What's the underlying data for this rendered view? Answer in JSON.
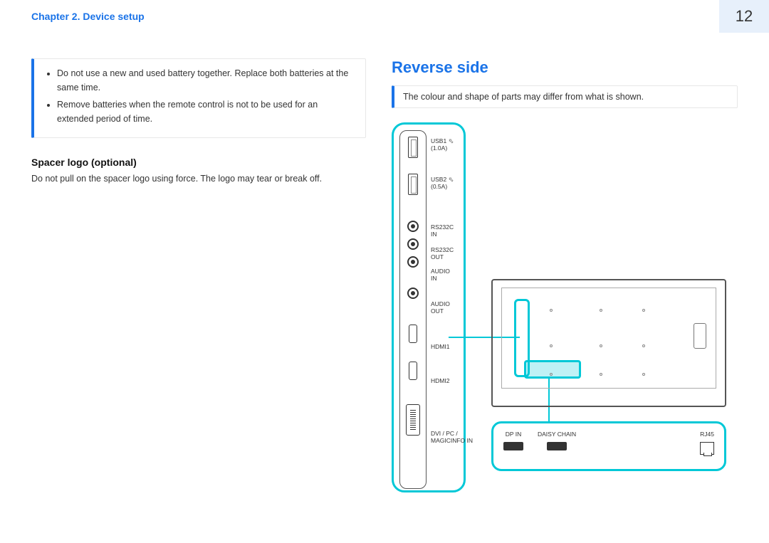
{
  "header": {
    "breadcrumb": "Chapter 2. Device setup",
    "page_number": "12"
  },
  "left": {
    "info_items": [
      "Do not use a new and used battery together. Replace both batteries at the same time.",
      "Remove batteries when the remote control is not to be used for an extended period of time."
    ],
    "spacer_heading": "Spacer logo (optional)",
    "spacer_body": "Do not pull on the spacer logo using force. The logo may tear or break off."
  },
  "right": {
    "title": "Reverse side",
    "note": "The colour and shape of parts may differ from what is shown.",
    "port_labels": {
      "usb1": "USB1",
      "usb1_amp": "(1.0A)",
      "usb2": "USB2",
      "usb2_amp": "(0.5A)",
      "rs232c_in": "RS232C IN",
      "rs232c_out": "RS232C OUT",
      "audio_in": "AUDIO IN",
      "audio_out": "AUDIO OUT",
      "hdmi1": "HDMI1",
      "hdmi2": "HDMI2",
      "dvi": "DVI / PC / MAGICINFO IN"
    },
    "bottom_ports": {
      "dp_in": "DP IN",
      "daisy_chain": "DAISY CHAIN",
      "rj45": "RJ45"
    }
  }
}
